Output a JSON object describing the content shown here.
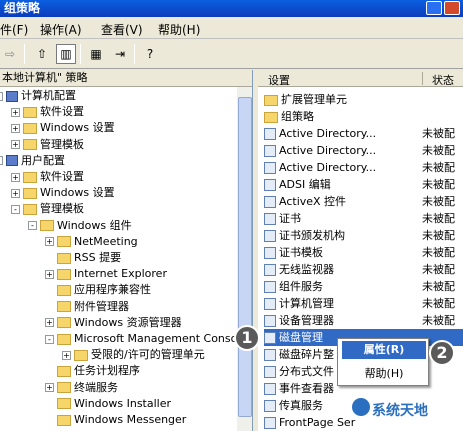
{
  "window": {
    "title": "组策略"
  },
  "menu": [
    "件(F)",
    "操作(A)",
    "查看(V)",
    "帮助(H)"
  ],
  "left": {
    "header": "本地计算机\" 策略",
    "tree": [
      {
        "label": "计算机配置",
        "icon": "computer-icon"
      },
      {
        "label": "软件设置",
        "icon": "folder-icon"
      },
      {
        "label": "Windows 设置",
        "icon": "folder-icon"
      },
      {
        "label": "管理模板",
        "icon": "folder-icon"
      },
      {
        "label": "用户配置",
        "icon": "computer-icon"
      },
      {
        "label": "软件设置",
        "icon": "folder-icon"
      },
      {
        "label": "Windows 设置",
        "icon": "folder-icon"
      },
      {
        "label": "管理模板",
        "icon": "folder-icon"
      },
      {
        "label": "Windows 组件",
        "icon": "folder-open-icon"
      },
      {
        "label": "NetMeeting",
        "icon": "folder-icon"
      },
      {
        "label": "RSS 提要",
        "icon": "folder-icon"
      },
      {
        "label": "Internet Explorer",
        "icon": "folder-icon"
      },
      {
        "label": "应用程序兼容性",
        "icon": "folder-icon"
      },
      {
        "label": "附件管理器",
        "icon": "folder-icon"
      },
      {
        "label": "Windows 资源管理器",
        "icon": "folder-icon"
      },
      {
        "label": "Microsoft Management Console",
        "icon": "folder-open-icon"
      },
      {
        "label": "受限的/许可的管理单元",
        "icon": "folder-icon"
      },
      {
        "label": "任务计划程序",
        "icon": "folder-icon"
      },
      {
        "label": "终端服务",
        "icon": "folder-icon"
      },
      {
        "label": "Windows Installer",
        "icon": "folder-icon"
      },
      {
        "label": "Windows Messenger",
        "icon": "folder-icon"
      }
    ]
  },
  "right": {
    "columns": [
      "设置",
      "状态"
    ],
    "rows": [
      {
        "label": "扩展管理单元",
        "status": "",
        "icon": "folder-icon"
      },
      {
        "label": "组策略",
        "status": "",
        "icon": "folder-icon"
      },
      {
        "label": "Active Directory...",
        "status": "未被配",
        "icon": "policy-icon"
      },
      {
        "label": "Active Directory...",
        "status": "未被配",
        "icon": "policy-icon"
      },
      {
        "label": "Active Directory...",
        "status": "未被配",
        "icon": "policy-icon"
      },
      {
        "label": "ADSI 编辑",
        "status": "未被配",
        "icon": "policy-icon"
      },
      {
        "label": "ActiveX 控件",
        "status": "未被配",
        "icon": "policy-icon"
      },
      {
        "label": "证书",
        "status": "未被配",
        "icon": "policy-icon"
      },
      {
        "label": "证书颁发机构",
        "status": "未被配",
        "icon": "policy-icon"
      },
      {
        "label": "证书模板",
        "status": "未被配",
        "icon": "policy-icon"
      },
      {
        "label": "无线监视器",
        "status": "未被配",
        "icon": "policy-icon"
      },
      {
        "label": "组件服务",
        "status": "未被配",
        "icon": "policy-icon"
      },
      {
        "label": "计算机管理",
        "status": "未被配",
        "icon": "policy-icon"
      },
      {
        "label": "设备管理器",
        "status": "未被配",
        "icon": "policy-icon"
      },
      {
        "label": "磁盘管理",
        "status": "",
        "icon": "policy-icon"
      },
      {
        "label": "磁盘碎片整",
        "status": "",
        "icon": "policy-icon"
      },
      {
        "label": "分布式文件",
        "status": "",
        "icon": "policy-icon"
      },
      {
        "label": "事件查看器",
        "status": "",
        "icon": "policy-icon"
      },
      {
        "label": "传真服务",
        "status": "",
        "icon": "policy-icon"
      },
      {
        "label": "FrontPage Ser",
        "status": "",
        "icon": "policy-icon"
      }
    ]
  },
  "context_menu": {
    "properties": "属性(R)",
    "help": "帮助(H)"
  },
  "annotations": {
    "badge1": "1",
    "badge2": "2"
  },
  "watermark": "系统天地"
}
